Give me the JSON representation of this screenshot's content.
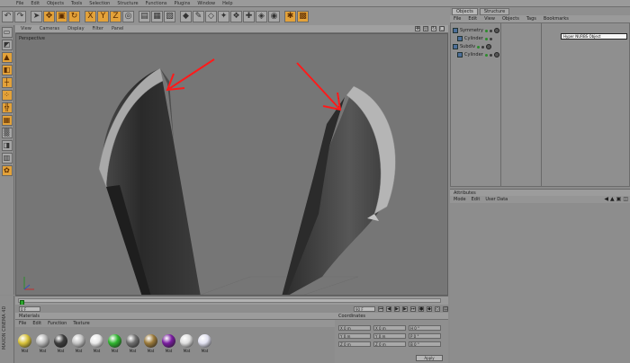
{
  "menubar": [
    "File",
    "Edit",
    "Objects",
    "Tools",
    "Selection",
    "Structure",
    "Functions",
    "Plugins",
    "Window",
    "Help"
  ],
  "toolbar": {
    "buttons": [
      "undo-icon",
      "redo-icon",
      "select-icon",
      "move-icon",
      "scale-icon",
      "rotate-icon",
      "x-axis-icon",
      "y-axis-icon",
      "z-axis-icon",
      "world-icon",
      "render-view-icon",
      "render-picture-icon",
      "render-settings-icon",
      "cube-icon",
      "pen-icon",
      "subdivide-icon",
      "array-icon",
      "nurbs-icon",
      "deformer-icon",
      "scene-icon",
      "camera-icon",
      "light-icon",
      "script-icon",
      "lock-icon"
    ]
  },
  "viewport": {
    "menu": [
      "View",
      "Cameras",
      "Display",
      "Filter",
      "Panel"
    ],
    "label": "Perspective"
  },
  "timeline": {
    "start": "0 F",
    "end": "90 F"
  },
  "materials": {
    "header": "Materials",
    "menu": [
      "File",
      "Edit",
      "Function",
      "Texture"
    ],
    "items": [
      {
        "name": "Mat",
        "color": "#d8c23a"
      },
      {
        "name": "Mat",
        "color": "#b9b9b9"
      },
      {
        "name": "Mat",
        "color": "#3c3c3c"
      },
      {
        "name": "Mat",
        "color": "#c4c4c4"
      },
      {
        "name": "Mat",
        "color": "#e8e8e8"
      },
      {
        "name": "Mat",
        "color": "#2fb52f"
      },
      {
        "name": "Mat",
        "color": "#6e6e6e"
      },
      {
        "name": "Mat",
        "color": "#9b7a3a"
      },
      {
        "name": "Mat",
        "color": "#7a1da0"
      },
      {
        "name": "Mat",
        "color": "#dedede"
      },
      {
        "name": "Mat",
        "color": "#e1e1f0"
      }
    ]
  },
  "coordinates": {
    "header": "Coordinates",
    "rows": [
      [
        "X 0 m",
        "X 0 m",
        "H 0 °"
      ],
      [
        "Y 0 m",
        "Y 0 m",
        "P 0 °"
      ],
      [
        "Z 0 m",
        "Z 0 m",
        "B 0 °"
      ]
    ],
    "apply": "Apply"
  },
  "object_manager": {
    "tabs": [
      "Objects",
      "Structure"
    ],
    "menu": [
      "File",
      "Edit",
      "View",
      "Objects",
      "Tags",
      "Bookmarks"
    ],
    "objects": [
      "Symmetry",
      "Cylinder",
      "Subdiv",
      "Cylinder"
    ],
    "tooltip": "Hyper NURBS Object"
  },
  "attributes": {
    "header": "Attributes",
    "menu": [
      "Mode",
      "Edit",
      "User Data"
    ]
  },
  "left_tools": [
    "viewport-icon",
    "model-icon",
    "object-icon",
    "texture-icon",
    "axis-icon",
    "points-icon",
    "edges-icon",
    "polygons-icon",
    "tweak-icon",
    "snap-icon",
    "workplane-icon",
    "bp-icon"
  ],
  "vertical_label": "MAXON CINEMA 4D",
  "colors": {
    "arrow": "#ff1a1a",
    "accent": "#e3a23a"
  }
}
